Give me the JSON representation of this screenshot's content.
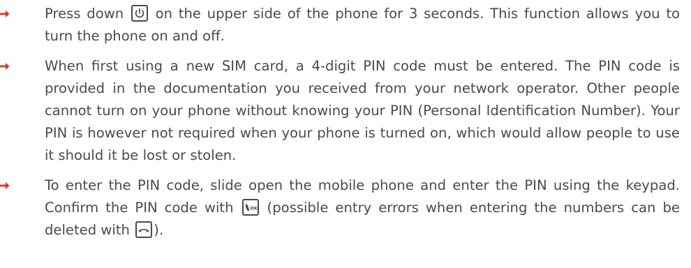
{
  "colors": {
    "text": "#4a4a4a",
    "bullet_arrow": "#e2301c"
  },
  "icons": {
    "bullet": "arrow-right-icon",
    "power_key": "power-icon",
    "call_ok_key": "call-ok-icon",
    "end_call_key": "end-call-icon"
  },
  "bullets": [
    {
      "part1": "Press down ",
      "part2": " on the upper side of the phone for 3 seconds. This function allows you to turn the phone on and off."
    },
    {
      "text": "When first using a new SIM card, a 4-digit PIN code must be entered. The PIN code is provided in the documentation you received from your network operator. Other people cannot turn on your phone without knowing your PIN (Personal Identification Number). Your PIN is however not required when your phone is turned on, which would allow people to use it should it be lost or stolen."
    },
    {
      "part1": "To enter the PIN code, slide open the mobile phone and enter the PIN using the keypad. Confirm the PIN code with ",
      "part2": " (possible entry errors when entering the numbers can be deleted with ",
      "part3": ")."
    }
  ]
}
